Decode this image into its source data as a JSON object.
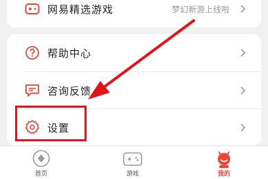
{
  "top_row": {
    "label": "网易精选游戏",
    "subtitle": "梦幻新游上线啦"
  },
  "menu": [
    {
      "label": "帮助中心"
    },
    {
      "label": "咨询反馈"
    },
    {
      "label": "设置"
    }
  ],
  "tabbar": {
    "tabs": [
      {
        "label": "首页",
        "icon": "home-icon",
        "active": false
      },
      {
        "label": "游戏",
        "icon": "gamepad-icon",
        "active": false
      },
      {
        "label": "我的",
        "icon": "profile-icon",
        "active": true
      }
    ]
  },
  "colors": {
    "accent": "#e9453a",
    "annotation": "#e3131a",
    "background": "#f1f1f1"
  }
}
